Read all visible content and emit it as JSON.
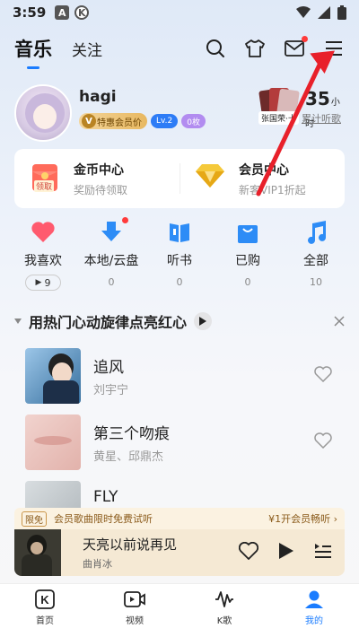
{
  "status_bar": {
    "time": "3:59",
    "badge1": "A",
    "badge2": "K"
  },
  "top_nav": {
    "tabs": [
      {
        "label": "音乐"
      },
      {
        "label": "关注"
      }
    ]
  },
  "profile": {
    "username": "hagi",
    "vip_label": "特惠会员价",
    "level_label": "Lv.2",
    "zero_label": "0枚",
    "album_caption": "张国荣·十",
    "listen_value": "35",
    "listen_unit": "小时",
    "listen_label": "累计听歌"
  },
  "coin_center": {
    "left_title": "金币中心",
    "left_sub": "奖励待领取",
    "left_badge": "领取",
    "right_title": "会员中心",
    "right_sub": "新客VIP1折起"
  },
  "shortcuts": [
    {
      "label": "我喜欢",
      "count": "9"
    },
    {
      "label": "本地/云盘",
      "count": "0"
    },
    {
      "label": "听书",
      "count": "0"
    },
    {
      "label": "已购",
      "count": "0"
    },
    {
      "label": "全部",
      "count": "10"
    }
  ],
  "recommend": {
    "title": "用热门心动旋律点亮红心",
    "songs": [
      {
        "title": "追风",
        "artist": "刘宇宁"
      },
      {
        "title": "第三个吻痕",
        "artist": "黄星、邱鼎杰"
      },
      {
        "title": "FLY",
        "artist": ""
      }
    ]
  },
  "promo": {
    "tag": "限免",
    "text": "会员歌曲限时免费试听",
    "right": "¥1开会员畅听 ›"
  },
  "mini_player": {
    "title": "天亮以前说再见",
    "artist": "曲肖冰"
  },
  "bottom_nav": [
    {
      "label": "首页",
      "icon": "K"
    },
    {
      "label": "视频"
    },
    {
      "label": "K歌"
    },
    {
      "label": "我的"
    }
  ],
  "colors": {
    "accent": "#1a7cff",
    "annotation": "#e8202a"
  }
}
